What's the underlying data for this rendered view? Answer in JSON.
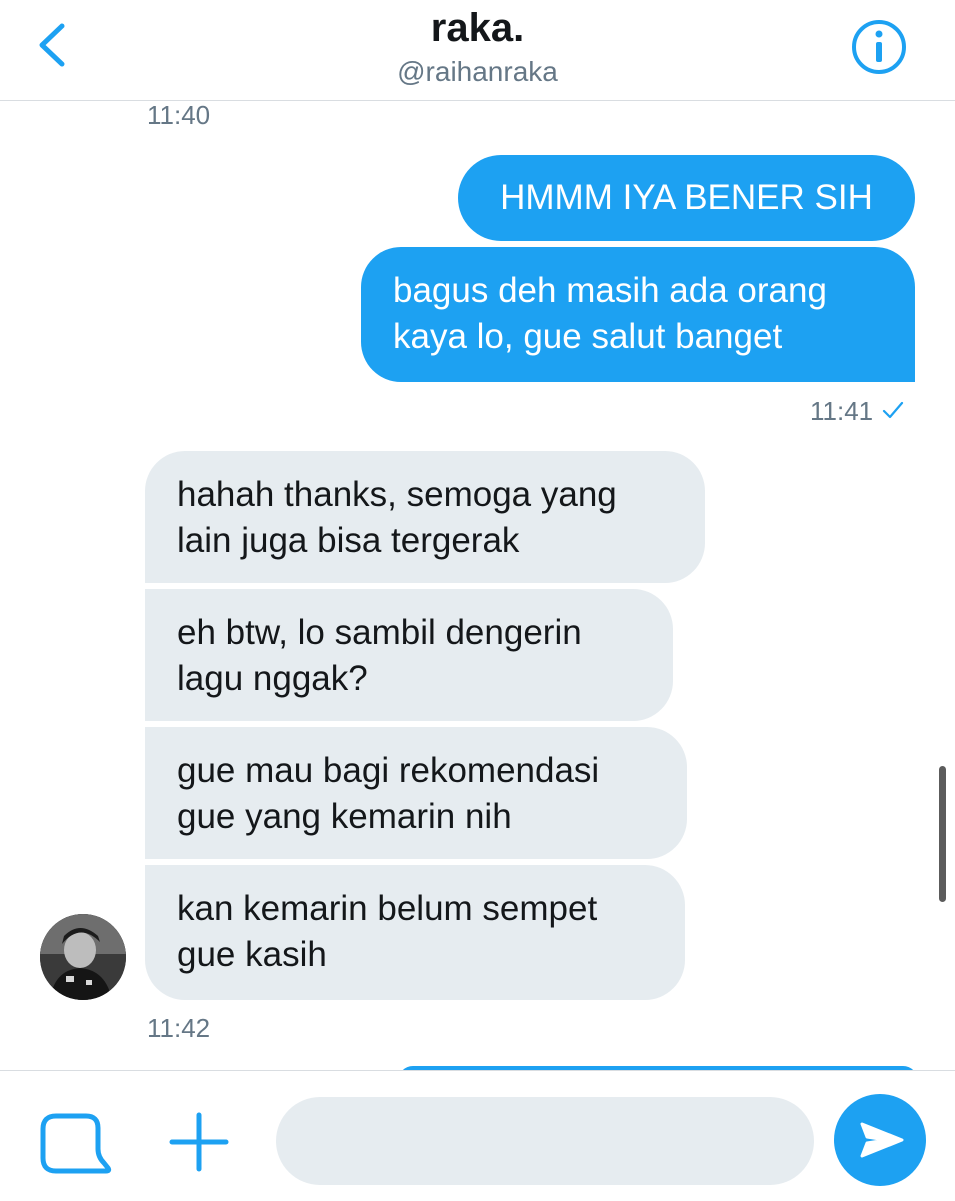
{
  "header": {
    "title": "raka.",
    "handle": "@raihanraka"
  },
  "messages": [
    {
      "type": "timestamp",
      "text": "11:40"
    },
    {
      "type": "sent",
      "text": "HMMM IYA BENER SIH"
    },
    {
      "type": "sent",
      "lines": [
        "bagus deh masih ada orang",
        "kaya lo, gue salut banget"
      ]
    },
    {
      "type": "timestamp",
      "text": "11:41",
      "status": "read"
    },
    {
      "type": "received",
      "lines": [
        "hahah thanks, semoga yang",
        "lain juga bisa tergerak"
      ]
    },
    {
      "type": "received",
      "lines": [
        "eh btw, lo sambil dengerin",
        "lagu nggak?"
      ]
    },
    {
      "type": "received",
      "lines": [
        "gue mau bagi rekomendasi",
        "gue yang kemarin nih"
      ]
    },
    {
      "type": "received",
      "lines": [
        "kan kemarin belum sempet",
        "gue kasih"
      ]
    },
    {
      "type": "timestamp",
      "text": "11:42"
    }
  ],
  "composer": {
    "placeholder": ""
  },
  "icons": {
    "back": "chevron-left-icon",
    "info": "info-icon",
    "compose": "gif-media-icon",
    "add": "plus-icon",
    "send": "send-icon",
    "read": "checkmark-icon"
  },
  "colors": {
    "accent": "#1da1f2",
    "received_bubble": "#e6ecf0",
    "muted_text": "#657786"
  }
}
